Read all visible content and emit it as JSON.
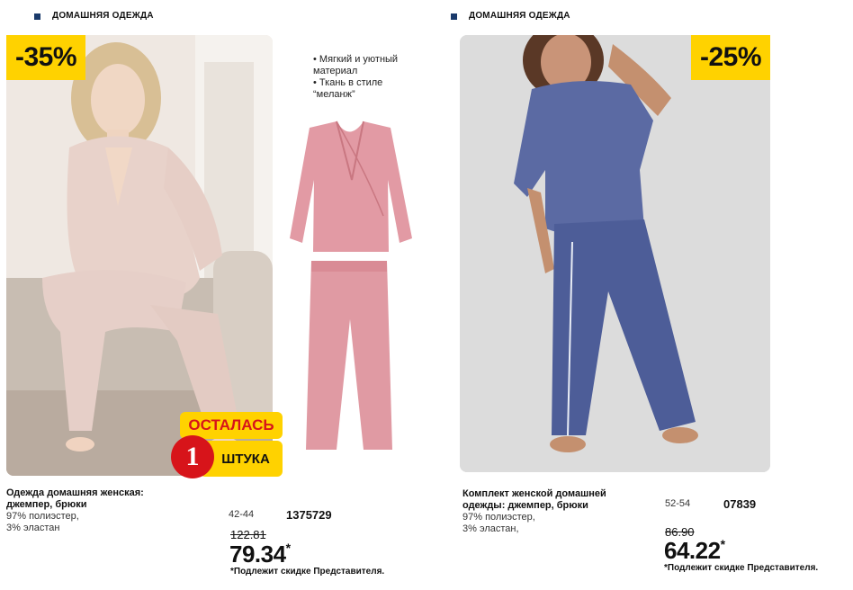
{
  "left": {
    "section_title": "ДОМАШНЯЯ ОДЕЖДА",
    "discount": "-35%",
    "features": [
      "• Мягкий и уютный материал",
      "• Ткань в стиле “меланж”"
    ],
    "stock_sticker": {
      "top": "ОСТАЛАСЬ",
      "count": "1",
      "bottom": "ШТУКА"
    },
    "product_name": "Одежда домашняя женская: джемпер, брюки",
    "composition": [
      "97% полиэстер,",
      "3% эластан"
    ],
    "sizes": "42-44",
    "code": "1375729",
    "old_price": "122.81",
    "price": "79.34",
    "price_star": "*",
    "note": "*Подлежит скидке Представителя."
  },
  "right": {
    "section_title": "ДОМАШНЯЯ ОДЕЖДА",
    "discount": "-25%",
    "product_name": "Комплект женской домашней одежды: джемпер, брюки",
    "composition": [
      "97% полиэстер,",
      "3% эластан,"
    ],
    "sizes": "52-54",
    "code": "07839",
    "old_price": "86.90",
    "price": "64.22",
    "price_star": "*",
    "note": "*Подлежит скидке Представителя."
  },
  "colors": {
    "badge": "#ffd200",
    "bullet": "#1a3a6b",
    "sticker_red": "#d7141a"
  }
}
